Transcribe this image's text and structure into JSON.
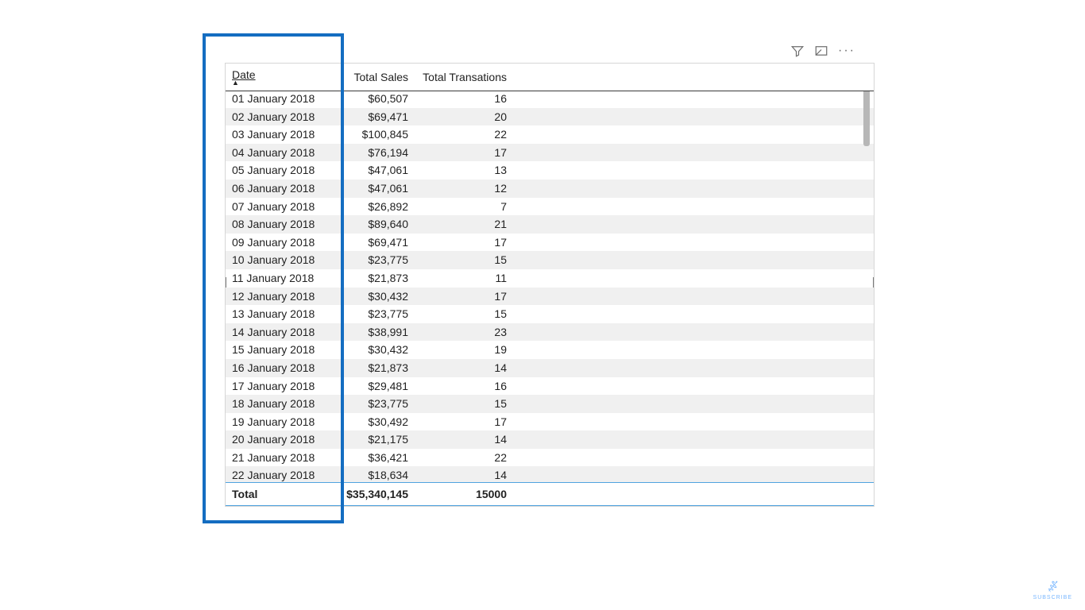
{
  "actions": {
    "filter": "Filter",
    "focus": "Focus mode",
    "more": "More options"
  },
  "table": {
    "columns": [
      "Date",
      "Total Sales",
      "Total Transations"
    ],
    "sort_column_index": 0,
    "sort_direction": "asc",
    "rows": [
      {
        "date": "01 January 2018",
        "sales": "$60,507",
        "trans": "16"
      },
      {
        "date": "02 January 2018",
        "sales": "$69,471",
        "trans": "20"
      },
      {
        "date": "03 January 2018",
        "sales": "$100,845",
        "trans": "22"
      },
      {
        "date": "04 January 2018",
        "sales": "$76,194",
        "trans": "17"
      },
      {
        "date": "05 January 2018",
        "sales": "$47,061",
        "trans": "13"
      },
      {
        "date": "06 January 2018",
        "sales": "$47,061",
        "trans": "12"
      },
      {
        "date": "07 January 2018",
        "sales": "$26,892",
        "trans": "7"
      },
      {
        "date": "08 January 2018",
        "sales": "$89,640",
        "trans": "21"
      },
      {
        "date": "09 January 2018",
        "sales": "$69,471",
        "trans": "17"
      },
      {
        "date": "10 January 2018",
        "sales": "$23,775",
        "trans": "15"
      },
      {
        "date": "11 January 2018",
        "sales": "$21,873",
        "trans": "11"
      },
      {
        "date": "12 January 2018",
        "sales": "$30,432",
        "trans": "17"
      },
      {
        "date": "13 January 2018",
        "sales": "$23,775",
        "trans": "15"
      },
      {
        "date": "14 January 2018",
        "sales": "$38,991",
        "trans": "23"
      },
      {
        "date": "15 January 2018",
        "sales": "$30,432",
        "trans": "19"
      },
      {
        "date": "16 January 2018",
        "sales": "$21,873",
        "trans": "14"
      },
      {
        "date": "17 January 2018",
        "sales": "$29,481",
        "trans": "16"
      },
      {
        "date": "18 January 2018",
        "sales": "$23,775",
        "trans": "15"
      },
      {
        "date": "19 January 2018",
        "sales": "$30,492",
        "trans": "17"
      },
      {
        "date": "20 January 2018",
        "sales": "$21,175",
        "trans": "14"
      },
      {
        "date": "21 January 2018",
        "sales": "$36,421",
        "trans": "22"
      },
      {
        "date": "22 January 2018",
        "sales": "$18,634",
        "trans": "14"
      }
    ],
    "total": {
      "label": "Total",
      "sales": "$35,340,145",
      "trans": "15000"
    }
  },
  "watermark": {
    "label": "SUBSCRIBE"
  },
  "highlight_color": "#146dc1"
}
